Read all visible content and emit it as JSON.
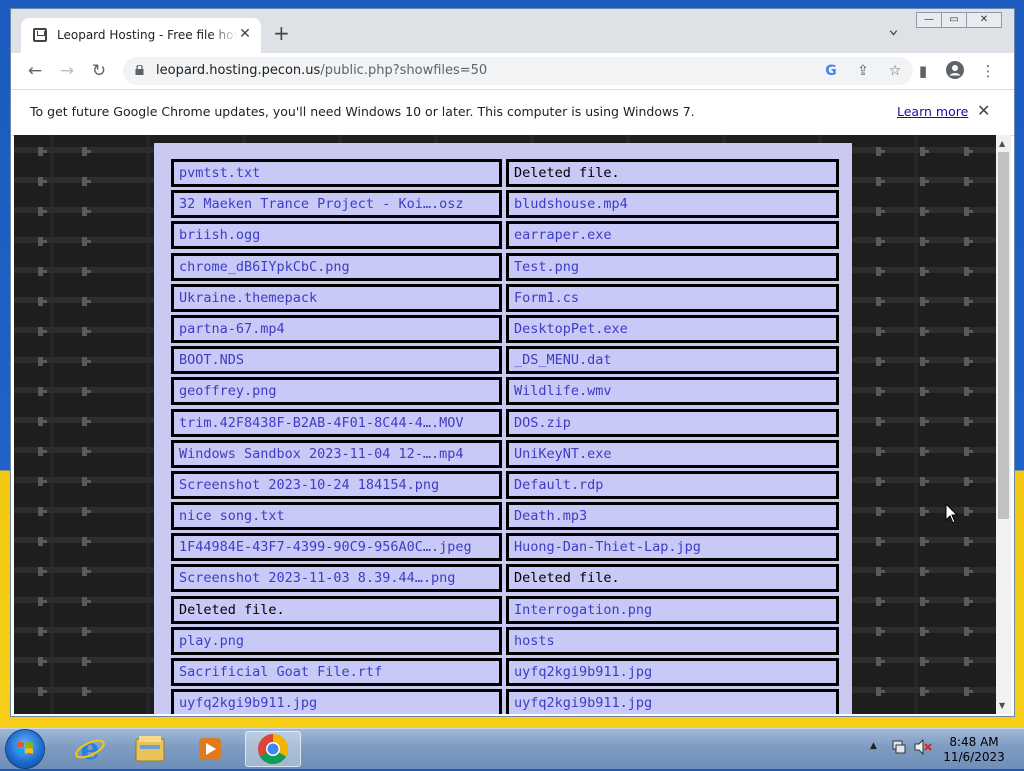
{
  "browser": {
    "tab_title": "Leopard Hosting - Free file hosting",
    "new_tab_label": "+",
    "url_host": "leopard.hosting.pecon.us",
    "url_rest": "/public.php?showfiles=50"
  },
  "infobar": {
    "message": "To get future Google Chrome updates, you'll need Windows 10 or later. This computer is using Windows 7.",
    "link": "Learn more"
  },
  "files": [
    [
      "pvmtst.txt",
      "Deleted file."
    ],
    [
      "32 Maeken Trance Project - Koi….osz",
      "bludshouse.mp4"
    ],
    [
      "briish.ogg",
      "earraper.exe"
    ],
    [
      "chrome_dB6IYpkCbC.png",
      "Test.png"
    ],
    [
      "Ukraine.themepack",
      "Form1.cs"
    ],
    [
      "partna-67.mp4",
      "DesktopPet.exe"
    ],
    [
      "BOOT.NDS",
      "_DS_MENU.dat"
    ],
    [
      "geoffrey.png",
      "Wildlife.wmv"
    ],
    [
      "trim.42F8438F-B2AB-4F01-8C44-4….MOV",
      "DOS.zip"
    ],
    [
      "Windows Sandbox 2023-11-04 12-….mp4",
      "UniKeyNT.exe"
    ],
    [
      "Screenshot 2023-10-24 184154.png",
      "Default.rdp"
    ],
    [
      "nice song.txt",
      "Death.mp3"
    ],
    [
      "1F44984E-43F7-4399-90C9-956A0C….jpeg",
      "Huong-Dan-Thiet-Lap.jpg"
    ],
    [
      "Screenshot 2023-11-03 8.39.44….png",
      "Deleted file."
    ],
    [
      "Deleted file.",
      "Interrogation.png"
    ],
    [
      "play.png",
      "hosts"
    ],
    [
      "Sacrificial Goat File.rtf",
      "uyfq2kgi9b911.jpg"
    ],
    [
      "uyfq2kgi9b911.jpg",
      "uyfq2kgi9b911.jpg"
    ]
  ],
  "deleted_label": "Deleted file.",
  "taskbar": {
    "time": "8:48 AM",
    "date": "11/6/2023",
    "apps": [
      "internet-explorer-icon",
      "windows-explorer-icon",
      "media-player-icon",
      "chrome-icon"
    ]
  },
  "colors": {
    "file_link": "#3d3dc4",
    "cell_bg": "#c9c9f7",
    "panel_bg": "#c9c9f2"
  }
}
